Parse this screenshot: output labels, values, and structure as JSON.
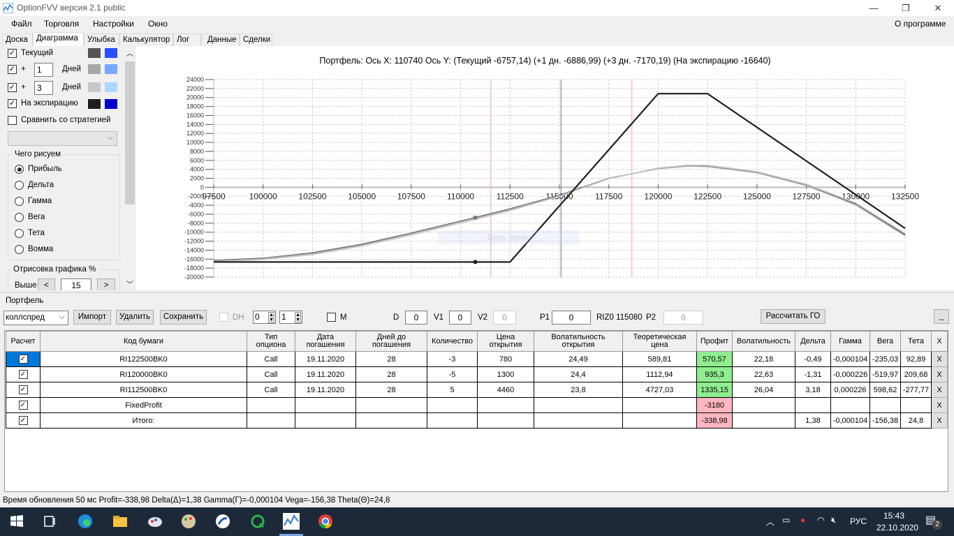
{
  "window": {
    "title": "OptionFVV версия 2.1 public",
    "minimize": "—",
    "maximize": "❐",
    "close": "✕"
  },
  "menu": {
    "items": [
      "Файл",
      "Торговля",
      "Настройки",
      "Окно"
    ],
    "about": "О программе"
  },
  "tabs": [
    "Доска",
    "Диаграмма",
    "Улыбка",
    "Калькулятор",
    "Лог",
    "Данные",
    "Сделки"
  ],
  "active_tab": "Диаграмма",
  "left_panel": {
    "current_label": "Текущий",
    "current_checked": true,
    "current_colors": [
      "#555555",
      "#2a4fff"
    ],
    "plus_label": "+",
    "days_label": "Дней",
    "day1_value": "1",
    "day1_colors": [
      "#a6a6a6",
      "#78a8ff"
    ],
    "day3_value": "3",
    "day3_colors": [
      "#c8c8c8",
      "#aad8ff"
    ],
    "expiry_label": "На экспирацию",
    "expiry_colors": [
      "#1e1e1e",
      "#0000c8"
    ],
    "compare_label": "Сравнить со стратегией",
    "compare_checked": false,
    "draw_group": "Чего рисуем",
    "draw_options": [
      "Прибыль",
      "Дельта",
      "Гамма",
      "Вега",
      "Тета",
      "Вомма"
    ],
    "draw_selected": "Прибыль",
    "render_group": "Отрисовка графика %",
    "above_label": "Выше",
    "above_value": "15",
    "dec": "<",
    "inc": ">"
  },
  "chart_header": {
    "text": "Портфель: Ось X: 110740 Ось Y:   (Текущий -6757,14)  (+1 дн. -6886,99)  (+3 дн. -7170,19)  (На экспирацию -16640)"
  },
  "chart_overlay": "Весь экран",
  "chart_data": {
    "type": "line",
    "xlim": [
      97500,
      132500
    ],
    "ylim": [
      -20000,
      24000
    ],
    "x_ticks": [
      97500,
      100000,
      102500,
      105000,
      107500,
      110000,
      112500,
      115000,
      117500,
      120000,
      122500,
      125000,
      127500,
      130000,
      132500
    ],
    "y_ticks": [
      24000,
      22000,
      20000,
      18000,
      16000,
      14000,
      12000,
      10000,
      8000,
      6000,
      4000,
      2000,
      0,
      -2000,
      -4000,
      -6000,
      -8000,
      -10000,
      -12000,
      -14000,
      -16000,
      -18000,
      -20000
    ],
    "grid": true,
    "vertical_lines": [
      {
        "x": 111530,
        "color": "#f0a0a8"
      },
      {
        "x": 115080,
        "color": "#5a7aa0"
      },
      {
        "x": 118670,
        "color": "#f0a0a8"
      }
    ],
    "series": [
      {
        "name": "Текущий",
        "color": "#555555",
        "points": [
          [
            97500,
            -16300
          ],
          [
            100000,
            -15800
          ],
          [
            102500,
            -14600
          ],
          [
            105000,
            -12700
          ],
          [
            107500,
            -10200
          ],
          [
            110740,
            -6757
          ],
          [
            112500,
            -4800
          ],
          [
            115000,
            -1800
          ],
          [
            117500,
            2000
          ],
          [
            120000,
            4200
          ],
          [
            121500,
            4750
          ],
          [
            122500,
            4650
          ],
          [
            125000,
            3300
          ],
          [
            127500,
            500
          ],
          [
            130000,
            -3700
          ],
          [
            132500,
            -10500
          ]
        ]
      },
      {
        "name": "+1 дн.",
        "color": "#a6a6a6",
        "points": [
          [
            97500,
            -16400
          ],
          [
            100000,
            -15900
          ],
          [
            102500,
            -14750
          ],
          [
            105000,
            -12850
          ],
          [
            107500,
            -10350
          ],
          [
            110740,
            -6887
          ],
          [
            112500,
            -4950
          ],
          [
            115000,
            -1900
          ],
          [
            117500,
            1950
          ],
          [
            120000,
            4150
          ],
          [
            121500,
            4700
          ],
          [
            122500,
            4620
          ],
          [
            125000,
            3250
          ],
          [
            127500,
            400
          ],
          [
            130000,
            -3900
          ],
          [
            132500,
            -10800
          ]
        ]
      },
      {
        "name": "+3 дн.",
        "color": "#c8c8c8",
        "points": [
          [
            97500,
            -16550
          ],
          [
            100000,
            -16100
          ],
          [
            102500,
            -15000
          ],
          [
            105000,
            -13100
          ],
          [
            107500,
            -10650
          ],
          [
            110740,
            -7170
          ],
          [
            112500,
            -5200
          ],
          [
            115000,
            -2000
          ],
          [
            117500,
            1900
          ],
          [
            120000,
            4300
          ],
          [
            121500,
            4950
          ],
          [
            122500,
            4900
          ],
          [
            125000,
            3500
          ],
          [
            127500,
            700
          ],
          [
            130000,
            -3500
          ],
          [
            132500,
            -10300
          ]
        ]
      },
      {
        "name": "На экспирацию",
        "color": "#1e1e1e",
        "points": [
          [
            97500,
            -16640
          ],
          [
            112500,
            -16640
          ],
          [
            120000,
            20860
          ],
          [
            122500,
            20860
          ],
          [
            132500,
            -9140
          ]
        ]
      }
    ],
    "markers": [
      {
        "x": 110740,
        "y": -6757,
        "color": "#777777"
      },
      {
        "x": 110740,
        "y": -16640,
        "color": "#1e1e1e"
      }
    ]
  },
  "portfolio": {
    "group": "Портфель",
    "strategy": "коллспред",
    "import": "Импорт",
    "delete": "Удалить",
    "save": "Сохранить",
    "dh": "DH",
    "spin1": "0",
    "spin2": "1",
    "m": "M",
    "d_label": "D",
    "d_value": "0",
    "v1_label": "V1",
    "v1_value": "0",
    "v2_label": "V2",
    "v2_value": "0",
    "p1_label": "P1",
    "p1_value": "0",
    "riz": "RIZ0 115080",
    "p2_label": "P2",
    "p2_value": "0",
    "calc_go": "Рассчитать ГО",
    "minimize": "_",
    "columns": [
      "Расчет",
      "Код бумаги",
      "Тип опциона",
      "Дата погашения",
      "Дней до погашения",
      "Количество",
      "Цена открытия",
      "Волатильность открытия",
      "Теоретическая цена",
      "Профит",
      "Волатильность",
      "Дельта",
      "Гамма",
      "Вега",
      "Тета",
      "X"
    ],
    "rows": [
      [
        "✓",
        "RI122500BK0",
        "Call",
        "19.11.2020",
        "28",
        "-3",
        "780",
        "24,49",
        "589,81",
        "570,57",
        "22,18",
        "-0,49",
        "-0,000104",
        "-235,03",
        "92,89",
        "X"
      ],
      [
        "✓",
        "RI120000BK0",
        "Call",
        "19.11.2020",
        "28",
        "-5",
        "1300",
        "24,4",
        "1112,94",
        "935,3",
        "22,63",
        "-1,31",
        "-0,000226",
        "-519,97",
        "209,68",
        "X"
      ],
      [
        "✓",
        "RI112500BK0",
        "Call",
        "19.11.2020",
        "28",
        "5",
        "4460",
        "23,8",
        "4727,03",
        "1335,15",
        "26,04",
        "3,18",
        "0,000226",
        "598,62",
        "-277,77",
        "X"
      ],
      [
        "✓",
        "FixedProfit",
        "",
        "",
        "",
        "",
        "",
        "",
        "",
        "-3180",
        "",
        "",
        "",
        "",
        "",
        "X"
      ],
      [
        "✓",
        "Итого:",
        "",
        "",
        "",
        "",
        "",
        "",
        "",
        "-338,98",
        "",
        "1,38",
        "-0,000104",
        "-156,38",
        "24,8",
        "X"
      ]
    ]
  },
  "status": "Время обновления 50 мс  Profit=-338,98 Delta(Δ)=1,38 Gamma(Γ)=-0,000104 Vega=-156,38 Theta(Θ)=24,8",
  "taskbar": {
    "lang": "РУС",
    "time": "15:43",
    "date": "22.10.2020",
    "notifications": "2"
  }
}
